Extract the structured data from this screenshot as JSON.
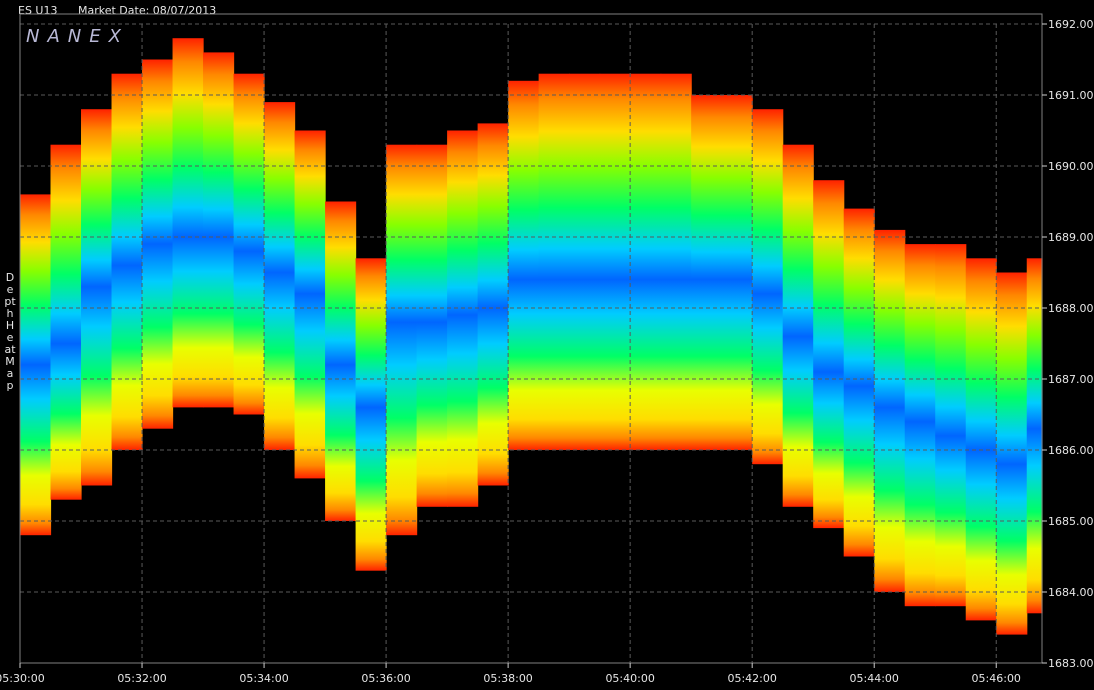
{
  "header": {
    "symbol": "ES U13",
    "market_date": "Market Date: 08/07/2013"
  },
  "watermark": "NANEX",
  "side_label": "Depth Heat Map",
  "colors": {
    "background": "#000000",
    "grid": "#5a5a5a",
    "axis": "#cfcfcf",
    "scale": [
      "#1f3cff",
      "#0066ff",
      "#00ccff",
      "#00ff66",
      "#88ff00",
      "#e8ff00",
      "#ffdd00",
      "#ff8800",
      "#ff2200"
    ]
  },
  "chart_data": {
    "type": "heatmap",
    "title": "",
    "xlabel": "",
    "ylabel": "",
    "x_ticks": [
      "05:30:00",
      "05:32:00",
      "05:34:00",
      "05:36:00",
      "05:38:00",
      "05:40:00",
      "05:42:00",
      "05:44:00",
      "05:46:00"
    ],
    "x_range": [
      "05:30:00",
      "05:46:45"
    ],
    "y_ticks": [
      "1692.00",
      "1691.00",
      "1690.00",
      "1689.00",
      "1688.00",
      "1687.00",
      "1686.00",
      "1685.00",
      "1684.00",
      "1683.00"
    ],
    "y_range": [
      1683.0,
      1692.0
    ],
    "grid": true,
    "y_axis_side": "right",
    "depth_bands": [
      {
        "time": "05:30:00",
        "low": 1684.8,
        "high": 1689.6,
        "peak": 1687.2
      },
      {
        "time": "05:30:30",
        "low": 1685.3,
        "high": 1690.3,
        "peak": 1687.5
      },
      {
        "time": "05:31:00",
        "low": 1685.5,
        "high": 1690.8,
        "peak": 1688.3
      },
      {
        "time": "05:31:30",
        "low": 1686.0,
        "high": 1691.3,
        "peak": 1688.6
      },
      {
        "time": "05:32:00",
        "low": 1686.3,
        "high": 1691.5,
        "peak": 1688.9
      },
      {
        "time": "05:32:30",
        "low": 1686.6,
        "high": 1691.8,
        "peak": 1689.0
      },
      {
        "time": "05:33:00",
        "low": 1686.6,
        "high": 1691.6,
        "peak": 1689.0
      },
      {
        "time": "05:33:30",
        "low": 1686.5,
        "high": 1691.3,
        "peak": 1688.8
      },
      {
        "time": "05:34:00",
        "low": 1686.0,
        "high": 1690.9,
        "peak": 1688.5
      },
      {
        "time": "05:34:30",
        "low": 1685.6,
        "high": 1690.5,
        "peak": 1688.2
      },
      {
        "time": "05:35:00",
        "low": 1685.0,
        "high": 1689.5,
        "peak": 1687.2
      },
      {
        "time": "05:35:30",
        "low": 1684.3,
        "high": 1688.7,
        "peak": 1686.6
      },
      {
        "time": "05:36:00",
        "low": 1684.8,
        "high": 1690.3,
        "peak": 1687.8
      },
      {
        "time": "05:36:30",
        "low": 1685.2,
        "high": 1690.3,
        "peak": 1687.8
      },
      {
        "time": "05:37:00",
        "low": 1685.2,
        "high": 1690.5,
        "peak": 1687.9
      },
      {
        "time": "05:37:30",
        "low": 1685.5,
        "high": 1690.6,
        "peak": 1688.0
      },
      {
        "time": "05:38:00",
        "low": 1686.0,
        "high": 1691.2,
        "peak": 1688.4
      },
      {
        "time": "05:38:30",
        "low": 1686.0,
        "high": 1691.3,
        "peak": 1688.4
      },
      {
        "time": "05:39:00",
        "low": 1686.0,
        "high": 1691.3,
        "peak": 1688.4
      },
      {
        "time": "05:39:30",
        "low": 1686.0,
        "high": 1691.3,
        "peak": 1688.4
      },
      {
        "time": "05:40:00",
        "low": 1686.0,
        "high": 1691.3,
        "peak": 1688.4
      },
      {
        "time": "05:40:30",
        "low": 1686.0,
        "high": 1691.3,
        "peak": 1688.4
      },
      {
        "time": "05:41:00",
        "low": 1686.0,
        "high": 1691.0,
        "peak": 1688.4
      },
      {
        "time": "05:41:30",
        "low": 1686.0,
        "high": 1691.0,
        "peak": 1688.4
      },
      {
        "time": "05:42:00",
        "low": 1685.8,
        "high": 1690.8,
        "peak": 1688.2
      },
      {
        "time": "05:42:30",
        "low": 1685.2,
        "high": 1690.3,
        "peak": 1687.6
      },
      {
        "time": "05:43:00",
        "low": 1684.9,
        "high": 1689.8,
        "peak": 1687.1
      },
      {
        "time": "05:43:30",
        "low": 1684.5,
        "high": 1689.4,
        "peak": 1686.9
      },
      {
        "time": "05:44:00",
        "low": 1684.0,
        "high": 1689.1,
        "peak": 1686.6
      },
      {
        "time": "05:44:30",
        "low": 1683.8,
        "high": 1688.9,
        "peak": 1686.4
      },
      {
        "time": "05:45:00",
        "low": 1683.8,
        "high": 1688.9,
        "peak": 1686.2
      },
      {
        "time": "05:45:30",
        "low": 1683.6,
        "high": 1688.7,
        "peak": 1686.0
      },
      {
        "time": "05:46:00",
        "low": 1683.4,
        "high": 1688.5,
        "peak": 1685.8
      },
      {
        "time": "05:46:30",
        "low": 1683.7,
        "high": 1688.7,
        "peak": 1686.3
      }
    ]
  }
}
